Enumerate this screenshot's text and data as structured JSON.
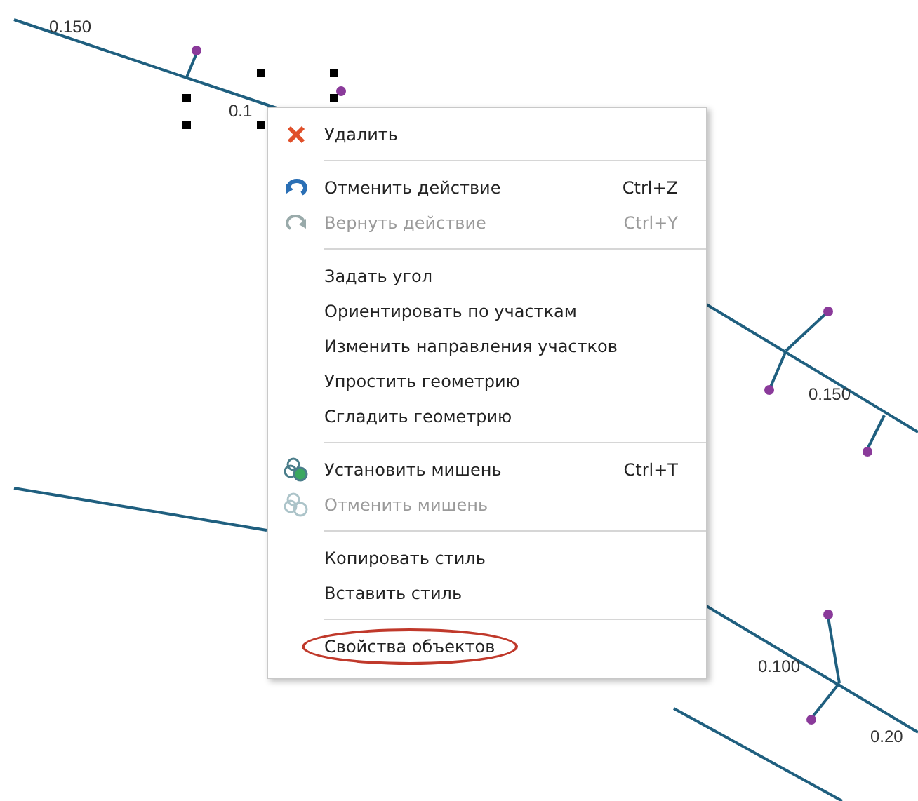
{
  "canvas": {
    "labels": [
      "0.150",
      "0.1",
      "0.150",
      "0.100",
      "0.20"
    ]
  },
  "context_menu": {
    "items": [
      {
        "kind": "delete",
        "label": "Удалить",
        "disabled": false,
        "circled": false
      },
      {
        "kind": "separator"
      },
      {
        "kind": "undo",
        "label": "Отменить действие",
        "shortcut": "Ctrl+Z",
        "disabled": false,
        "circled": false
      },
      {
        "kind": "redo",
        "label": "Вернуть действие",
        "shortcut": "Ctrl+Y",
        "disabled": true,
        "circled": false
      },
      {
        "kind": "separator"
      },
      {
        "kind": "item",
        "label": "Задать угол",
        "disabled": false,
        "circled": false
      },
      {
        "kind": "item",
        "label": "Ориентировать по участкам",
        "disabled": false,
        "circled": false
      },
      {
        "kind": "item",
        "label": "Изменить направления участков",
        "disabled": false,
        "circled": false
      },
      {
        "kind": "item",
        "label": "Упростить геометрию",
        "disabled": false,
        "circled": false
      },
      {
        "kind": "item",
        "label": "Сгладить геометрию",
        "disabled": false,
        "circled": false
      },
      {
        "kind": "separator"
      },
      {
        "kind": "target",
        "label": "Установить мишень",
        "shortcut": "Ctrl+T",
        "disabled": false,
        "circled": false
      },
      {
        "kind": "target",
        "label": "Отменить мишень",
        "disabled": true,
        "circled": false
      },
      {
        "kind": "separator"
      },
      {
        "kind": "item",
        "label": "Копировать стиль",
        "disabled": false,
        "circled": false
      },
      {
        "kind": "item",
        "label": "Вставить стиль",
        "disabled": false,
        "circled": false
      },
      {
        "kind": "separator"
      },
      {
        "kind": "item",
        "label": "Свойства объектов",
        "disabled": false,
        "circled": true
      }
    ]
  }
}
